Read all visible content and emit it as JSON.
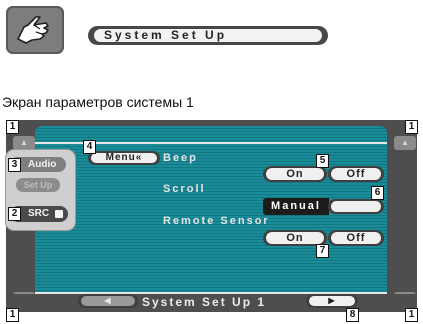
{
  "header": {
    "title": "System Set Up",
    "caption": "Экран параметров системы 1"
  },
  "icons": {
    "hand": "pointing-hand-icon",
    "up": "up-arrow-icon",
    "down": "down-arrow-icon",
    "prev": "left-arrow-icon",
    "next": "right-arrow-icon",
    "return": "return-arrow-icon"
  },
  "left_panel": {
    "audio_label": "Audio",
    "setup_label": "Set Up",
    "src_label": "SRC"
  },
  "menu": {
    "menu_label": "Menu«",
    "beep_label": "Beep",
    "beep_on": "On",
    "beep_off": "Off",
    "scroll_label": "Scroll",
    "scroll_value": "Manual",
    "remote_label": "Remote Sensor",
    "remote_on": "On",
    "remote_off": "Off"
  },
  "footer": {
    "page_title": "System Set Up 1"
  },
  "markers": [
    "1",
    "1",
    "3",
    "2",
    "4",
    "5",
    "6",
    "7",
    "1",
    "8",
    "1"
  ],
  "colors": {
    "stripe_primary": "#1a8b98",
    "stripe_secondary": "#137782",
    "frame": "#4e4e4e"
  }
}
